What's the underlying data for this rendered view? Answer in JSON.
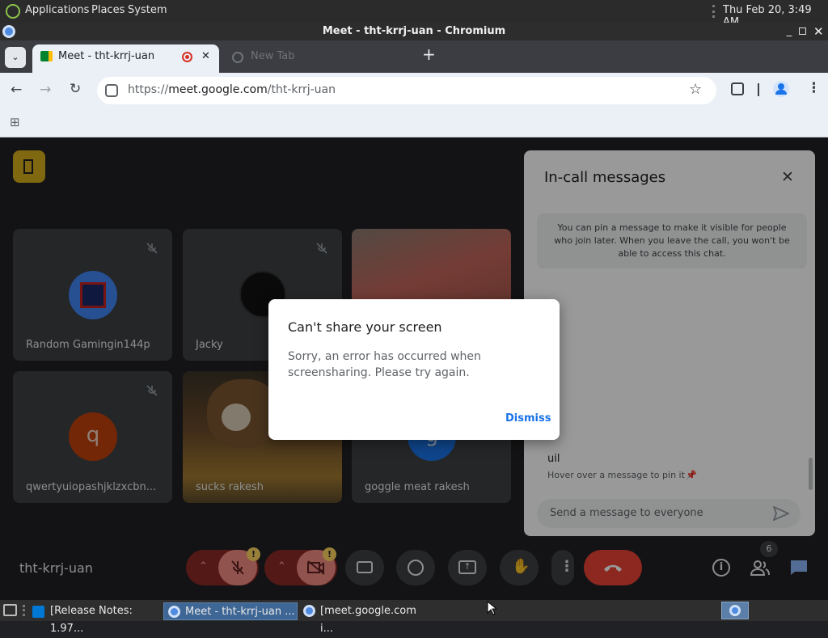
{
  "desktop": {
    "menus": [
      "Applications",
      "Places",
      "System"
    ],
    "clock": "Thu Feb 20,  3:49 AM"
  },
  "window": {
    "title": "Meet - tht-krrj-uan - Chromium"
  },
  "tabs": [
    {
      "label": "Meet - tht-krrj-uan",
      "active": true
    },
    {
      "label": "New Tab",
      "active": false
    }
  ],
  "omnibox": {
    "url_prefix": "https://",
    "url_host": "meet.google.com",
    "url_path": "/tht-krrj-uan"
  },
  "meet": {
    "meeting_code": "tht-krrj-uan",
    "participants": [
      {
        "name": "Random Gamingin144p"
      },
      {
        "name": "Jacky"
      },
      {
        "name": ""
      },
      {
        "name": "qwertyuiopashjklzxcbn...",
        "initial": "q"
      },
      {
        "name": "sucks rakesh"
      },
      {
        "name": "goggle meat rakesh",
        "initial": "g"
      }
    ],
    "people_count": "6"
  },
  "chat": {
    "title": "In-call messages",
    "pin_notice": "You can pin a message to make it visible for people who join later. When you leave the call, you won't be able to access this chat.",
    "message_text": "uil",
    "hover_hint": "Hover over a message to pin it",
    "input_placeholder": "Send a message to everyone"
  },
  "dialog": {
    "title": "Can't share your screen",
    "body": "Sorry, an error has occurred when screensharing. Please try again.",
    "dismiss_label": "Dismiss"
  },
  "taskbar": {
    "items": [
      "[Release Notes: 1.97...",
      "Meet - tht-krrj-uan ...",
      "[meet.google.com i..."
    ]
  },
  "colors": {
    "accent": "#1a73e8",
    "meet_bg": "#202124",
    "end_call": "#ea4335"
  }
}
